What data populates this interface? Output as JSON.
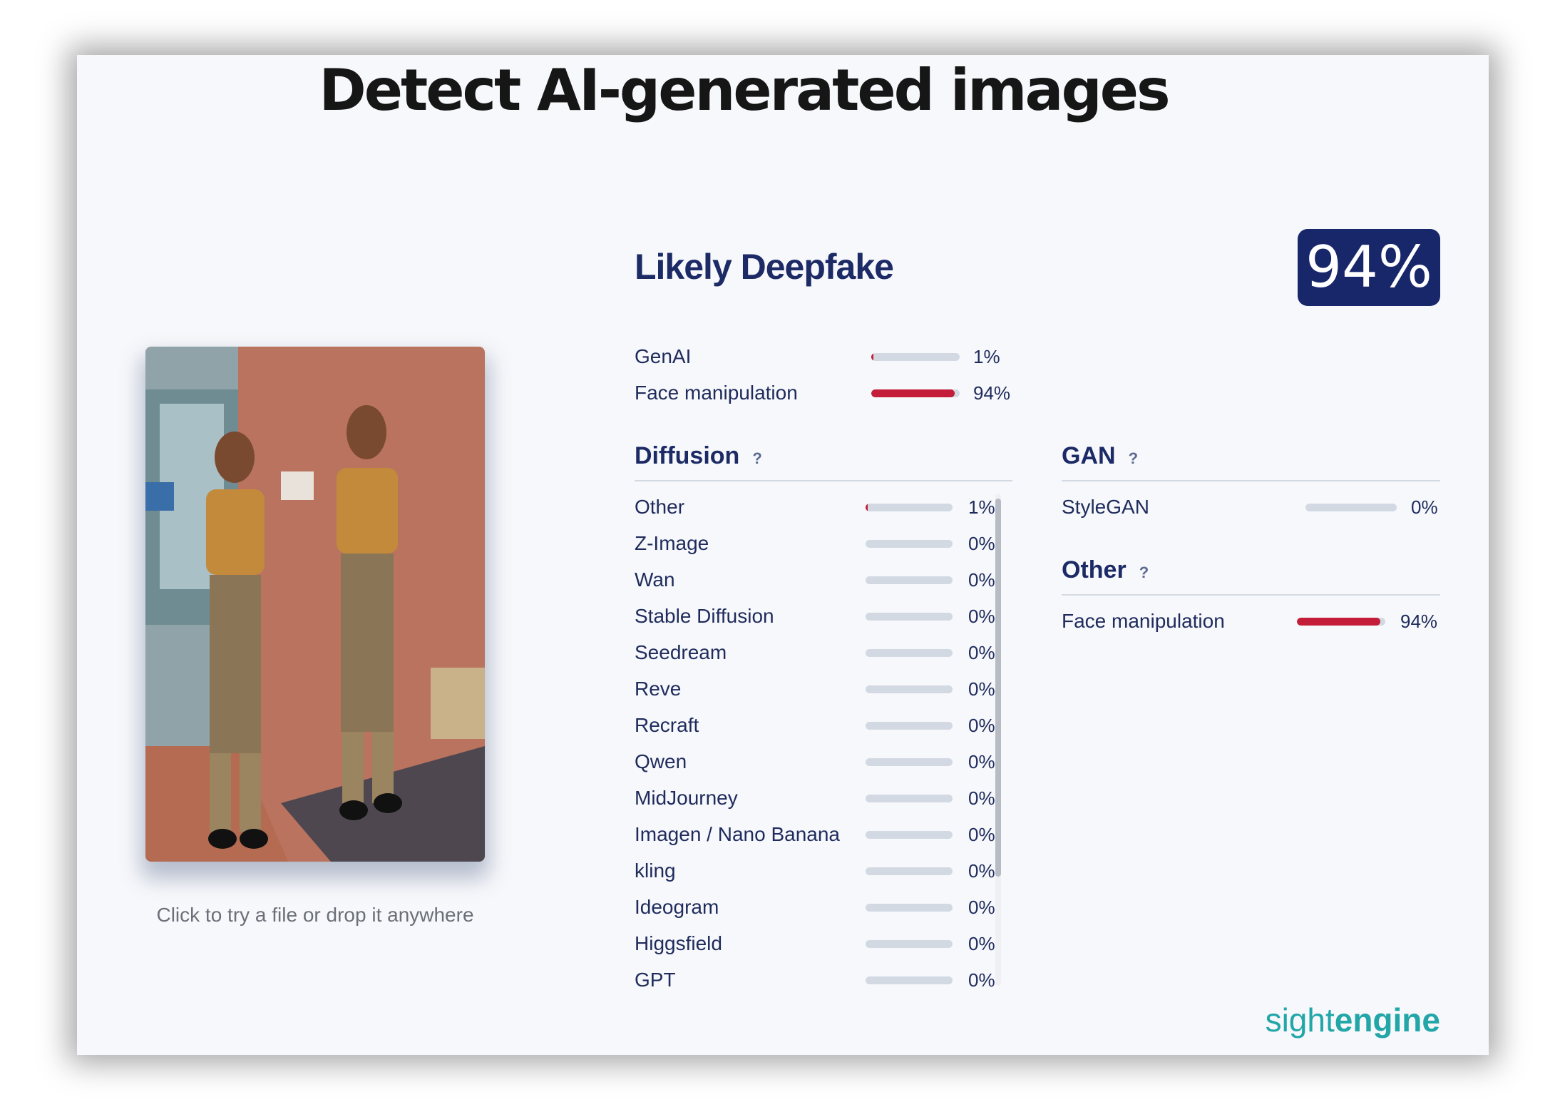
{
  "title": "Detect AI-generated images",
  "upload": {
    "hint": "Click to try a file or drop it anywhere"
  },
  "result": {
    "verdict": "Likely Deepfake",
    "score": "94%"
  },
  "summary": [
    {
      "label": "GenAI",
      "value": 0.01,
      "text": "1%"
    },
    {
      "label": "Face manipulation",
      "value": 0.94,
      "text": "94%"
    }
  ],
  "diffusion": {
    "heading": "Diffusion",
    "help": "?",
    "items": [
      {
        "label": "Other",
        "value": 0.01,
        "text": "1%"
      },
      {
        "label": "Z-Image",
        "value": 0,
        "text": "0%"
      },
      {
        "label": "Wan",
        "value": 0,
        "text": "0%"
      },
      {
        "label": "Stable Diffusion",
        "value": 0,
        "text": "0%"
      },
      {
        "label": "Seedream",
        "value": 0,
        "text": "0%"
      },
      {
        "label": "Reve",
        "value": 0,
        "text": "0%"
      },
      {
        "label": "Recraft",
        "value": 0,
        "text": "0%"
      },
      {
        "label": "Qwen",
        "value": 0,
        "text": "0%"
      },
      {
        "label": "MidJourney",
        "value": 0,
        "text": "0%"
      },
      {
        "label": "Imagen / Nano Banana",
        "value": 0,
        "text": "0%"
      },
      {
        "label": "kling",
        "value": 0,
        "text": "0%"
      },
      {
        "label": "Ideogram",
        "value": 0,
        "text": "0%"
      },
      {
        "label": "Higgsfield",
        "value": 0,
        "text": "0%"
      },
      {
        "label": "GPT",
        "value": 0,
        "text": "0%"
      }
    ]
  },
  "gan": {
    "heading": "GAN",
    "help": "?",
    "items": [
      {
        "label": "StyleGAN",
        "value": 0,
        "text": "0%"
      }
    ]
  },
  "other": {
    "heading": "Other",
    "help": "?",
    "items": [
      {
        "label": "Face manipulation",
        "value": 0.94,
        "text": "94%"
      }
    ]
  },
  "brand": {
    "light": "sight",
    "bold": "engine"
  },
  "colors": {
    "accent": "#18266a",
    "danger": "#c41d3a",
    "bar_track": "#d3d9e2",
    "brand": "#22a6a8"
  }
}
